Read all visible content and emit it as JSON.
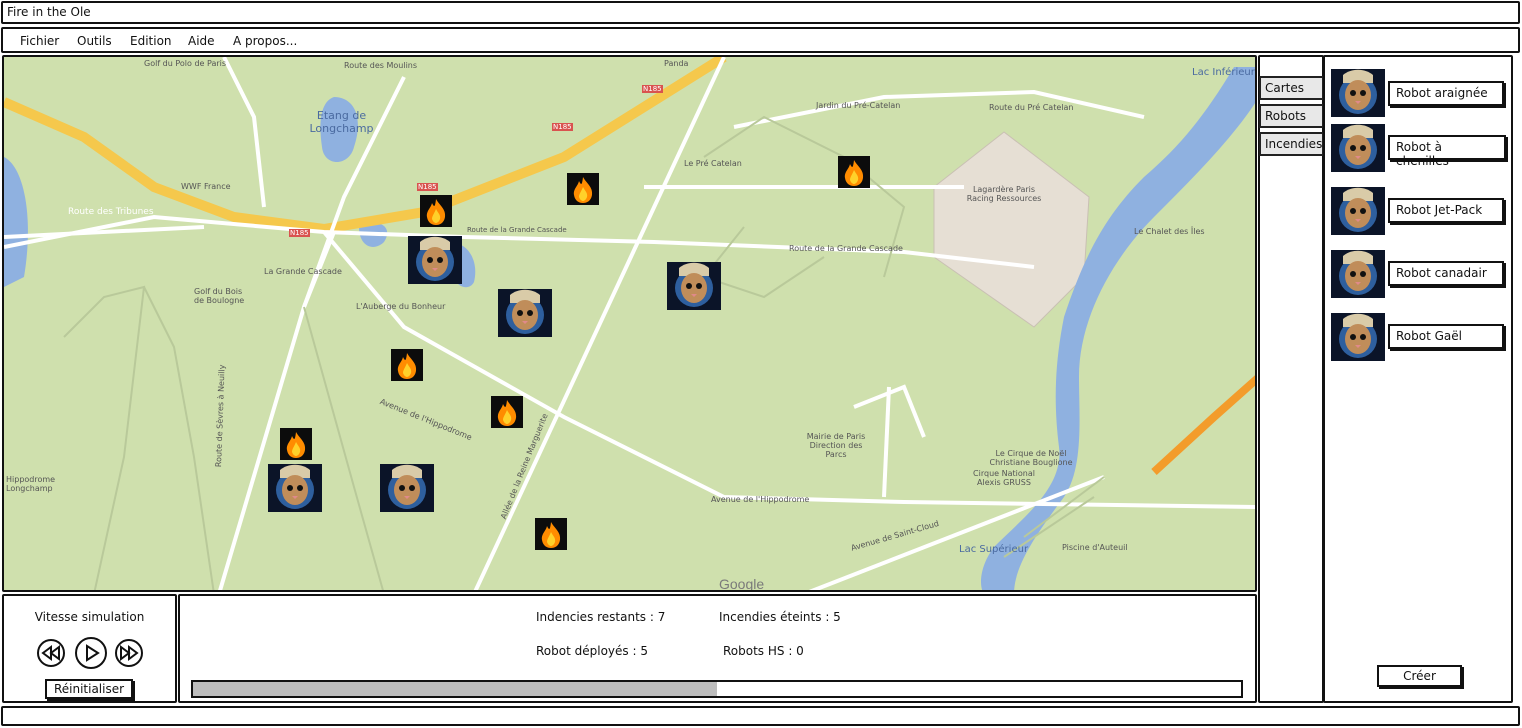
{
  "window": {
    "title": "Fire in the Ole"
  },
  "menu": [
    "Fichier",
    "Outils",
    "Edition",
    "Aide",
    "A propos..."
  ],
  "map": {
    "labels": [
      "Golf du Polo de Paris",
      "Route des Moulins",
      "Etang de Longchamp",
      "Panda",
      "N185",
      "N185",
      "N185",
      "N185",
      "Jardin du Pré-Catelan",
      "Route du Pré Catelan",
      "Lac Inférieur",
      "Lagardère Paris Racing Ressources",
      "Le Pré Catelan",
      "WWF France",
      "Route des Tribunes",
      "Route de la Grande Cascade",
      "Route de la Grande Cascade",
      "Le Chalet des Îles",
      "La Grande Cascade",
      "Golf du Bois de Boulogne",
      "L'Auberge du Bonheur",
      "Avenue de l'Hippodrome",
      "Allée de la Reine Marguerite",
      "Mairie de Paris Direction des Parcs",
      "Le Cirque de Noël Christiane Bouglione",
      "Cirque National Alexis GRUSS",
      "Avenue de l'Hippodrome",
      "Avenue de Saint-Cloud",
      "Lac Supérieur",
      "Piscine d'Auteuil",
      "Google",
      "Route de Sèvres à Neuilly",
      "Hippodrome Longchamp"
    ],
    "fire_icon": "fire-icon",
    "robot_icon": "cat-robot-icon"
  },
  "tabs": [
    "Cartes",
    "Robots",
    "Incendies"
  ],
  "robots": [
    "Robot araignée",
    "Robot à chenilles",
    "Robot Jet-Pack",
    "Robot canadair",
    "Robot Gaël"
  ],
  "create_label": "Créer",
  "simulation": {
    "speed_label": "Vitesse simulation",
    "reset_label": "Réinitialiser",
    "controls": [
      "rewind-icon",
      "play-icon",
      "fast-forward-icon"
    ]
  },
  "stats": {
    "remaining": "Indencies restants : 7",
    "extinguished": "Incendies éteints : 5",
    "deployed": "Robot déployés : 5",
    "broken": "Robots HS : 0"
  },
  "progress": 0.5,
  "colors": {
    "map_park": "#cfe0ad",
    "water": "#8fb1e0",
    "highway": "#f5c84c",
    "fire": "#ff8c00"
  }
}
